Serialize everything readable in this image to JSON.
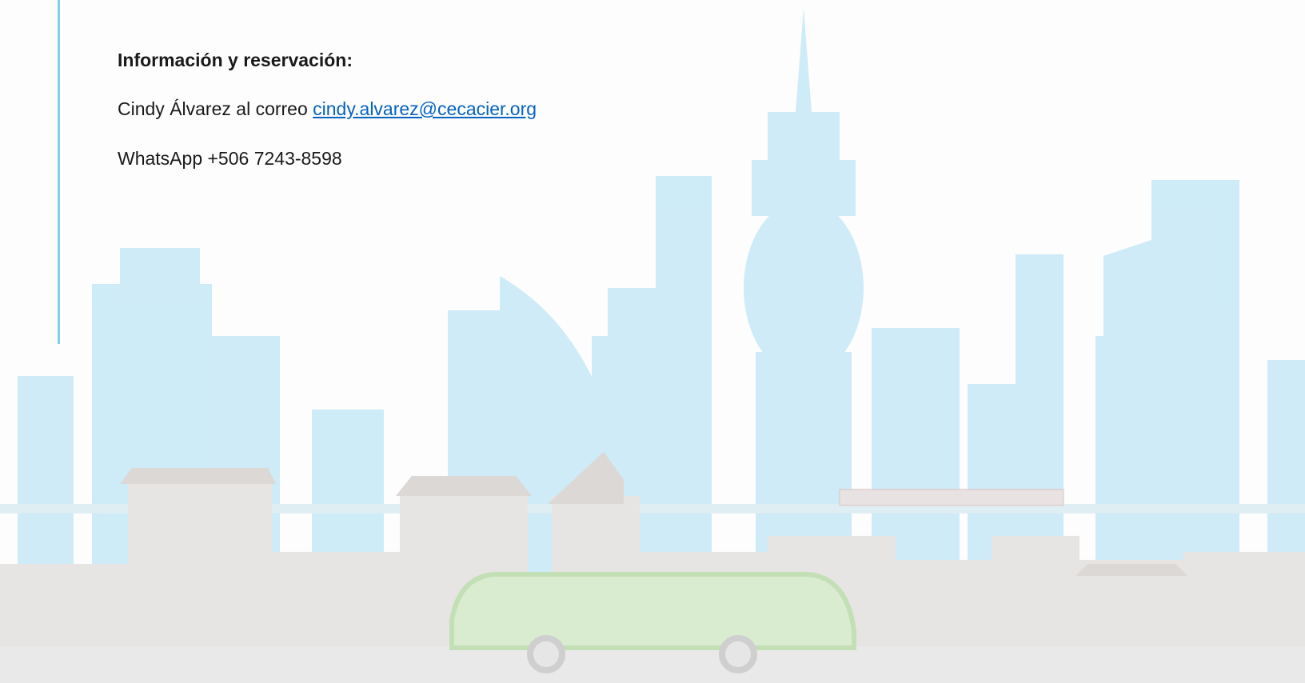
{
  "heading": "Información y reservación:",
  "contact": {
    "prefix": "Cindy Álvarez al correo ",
    "email": "cindy.alvarez@cecacier.org"
  },
  "whatsapp": "WhatsApp +506 7243-8598",
  "colors": {
    "link": "#0563c1",
    "skyline": "#bfe6f5",
    "ground": "#e6e6e6",
    "bus": "#cfe8c4"
  }
}
